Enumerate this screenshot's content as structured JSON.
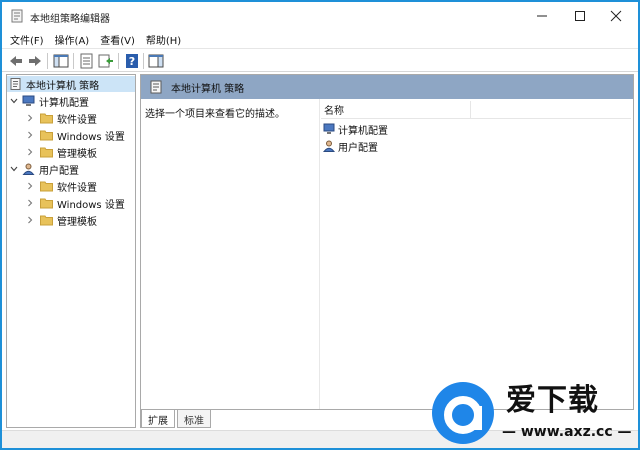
{
  "window": {
    "title": "本地组策略编辑器",
    "controls": {
      "minimize": "minimize-icon",
      "maximize": "maximize-icon",
      "close": "close-icon"
    }
  },
  "menu": {
    "items": [
      {
        "label": "文件(F)"
      },
      {
        "label": "操作(A)"
      },
      {
        "label": "查看(V)"
      },
      {
        "label": "帮助(H)"
      }
    ]
  },
  "toolbar": {
    "buttons": [
      "back-icon",
      "forward-icon",
      "show-hide-tree-icon",
      "properties-icon",
      "export-list-icon",
      "help-icon",
      "show-hide-action-pane-icon"
    ]
  },
  "tree": {
    "root": {
      "label": "本地计算机 策略"
    },
    "computer": {
      "label": "计算机配置",
      "children": [
        {
          "label": "软件设置"
        },
        {
          "label": "Windows 设置"
        },
        {
          "label": "管理模板"
        }
      ]
    },
    "user": {
      "label": "用户配置",
      "children": [
        {
          "label": "软件设置"
        },
        {
          "label": "Windows 设置"
        },
        {
          "label": "管理模板"
        }
      ]
    }
  },
  "details": {
    "header_title": "本地计算机 策略",
    "description": "选择一个项目来查看它的描述。",
    "column_name": "名称",
    "items": [
      {
        "label": "计算机配置"
      },
      {
        "label": "用户配置"
      }
    ]
  },
  "tabs": [
    {
      "label": "扩展"
    },
    {
      "label": "标准"
    }
  ],
  "watermark": {
    "brand": "爱下载",
    "url": "— www.axz.cc —"
  },
  "colors": {
    "window_border": "#1e90d8",
    "header_bar": "#8ea6c4",
    "selection": "#cce4f7",
    "folder": "#e8c25a",
    "watermark_blue": "#1f86e8"
  }
}
